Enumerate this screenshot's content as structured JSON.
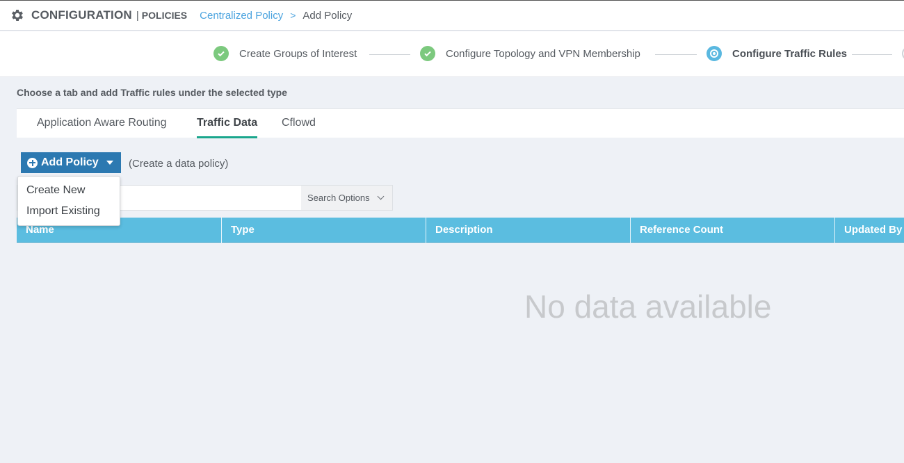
{
  "header": {
    "section": "CONFIGURATION",
    "separator": "|",
    "subsection": "POLICIES",
    "breadcrumb_link": "Centralized Policy",
    "breadcrumb_arrow": ">",
    "breadcrumb_current": "Add Policy",
    "icon": "gear-icon"
  },
  "stepper": {
    "steps": [
      {
        "label": "Create Groups of Interest",
        "status": "complete"
      },
      {
        "label": "Configure Topology and VPN Membership",
        "status": "complete"
      },
      {
        "label": "Configure Traffic Rules",
        "status": "current"
      }
    ]
  },
  "instruction": "Choose a tab and add Traffic rules under the selected type",
  "tabs": [
    {
      "label": "Application Aware Routing",
      "active": false
    },
    {
      "label": "Traffic Data",
      "active": true
    },
    {
      "label": "Cflowd",
      "active": false
    }
  ],
  "add_policy": {
    "label": "Add Policy",
    "note": "(Create a data policy)",
    "menu": [
      "Create New",
      "Import Existing"
    ]
  },
  "search": {
    "placeholder": "",
    "options_label": "Search Options"
  },
  "table": {
    "columns": [
      "Name",
      "Type",
      "Description",
      "Reference Count",
      "Updated By"
    ],
    "empty_text": "No data available"
  },
  "colors": {
    "header_blue": "#5bbde0",
    "button_blue": "#2c79b1",
    "step_complete": "#7cc97e",
    "step_current": "#5ab8e0",
    "tab_active": "#1aa68c",
    "link": "#4aa3df"
  }
}
